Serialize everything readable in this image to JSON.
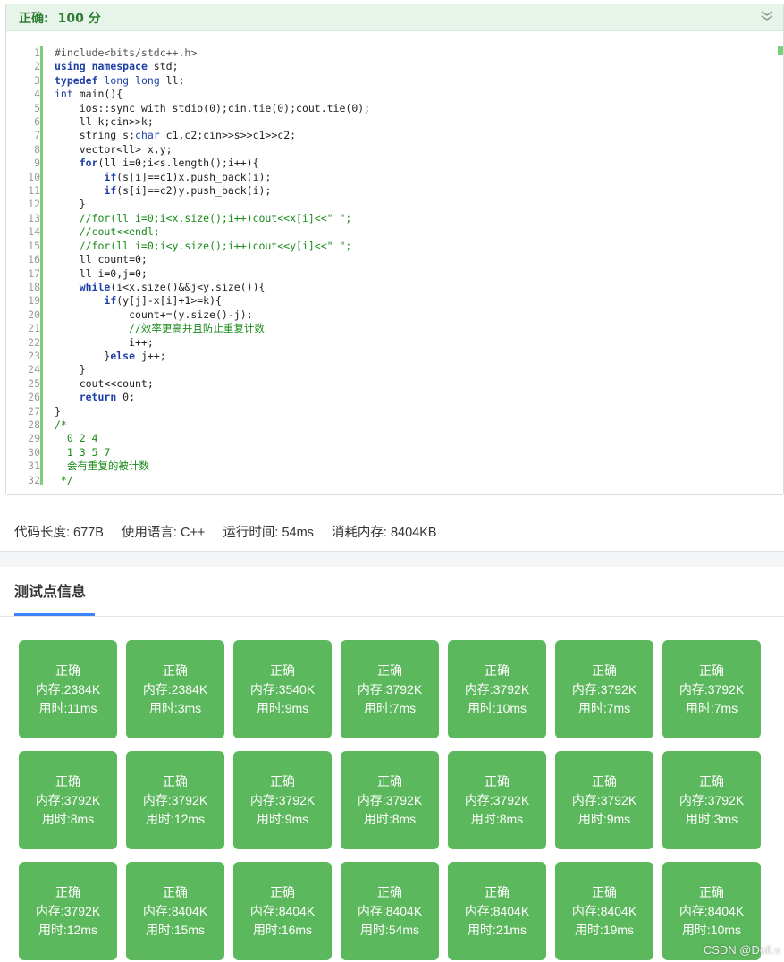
{
  "header": {
    "status": "正确:",
    "score": "100 分"
  },
  "code": {
    "line_numbers": [
      "1",
      "2",
      "3",
      "4",
      "5",
      "6",
      "7",
      "8",
      "9",
      "10",
      "11",
      "12",
      "13",
      "14",
      "15",
      "16",
      "17",
      "18",
      "19",
      "20",
      "21",
      "22",
      "23",
      "24",
      "25",
      "26",
      "27",
      "28",
      "29",
      "30",
      "31",
      "32"
    ],
    "lines": [
      "#include<bits/stdc++.h>",
      "using namespace std;",
      "typedef long long ll;",
      "int main(){",
      "    ios::sync_with_stdio(0);cin.tie(0);cout.tie(0);",
      "    ll k;cin>>k;",
      "    string s;char c1,c2;cin>>s>>c1>>c2;",
      "    vector<ll> x,y;",
      "    for(ll i=0;i<s.length();i++){",
      "        if(s[i]==c1)x.push_back(i);",
      "        if(s[i]==c2)y.push_back(i);",
      "    }",
      "    //for(ll i=0;i<x.size();i++)cout<<x[i]<<\" \";",
      "    //cout<<endl;",
      "    //for(ll i=0;i<y.size();i++)cout<<y[i]<<\" \";",
      "    ll count=0;",
      "    ll i=0,j=0;",
      "    while(i<x.size()&&j<y.size()){",
      "        if(y[j]-x[i]+1>=k){",
      "            count+=(y.size()-j);",
      "            //效率更高并且防止重复计数",
      "            i++;",
      "        }else j++;",
      "    }",
      "    cout<<count;",
      "    return 0;",
      "}",
      "/*",
      "  0 2 4",
      "  1 3 5 7",
      "  会有重复的被计数",
      " */"
    ]
  },
  "stats": {
    "code_length": "代码长度: 677B",
    "language": "使用语言: C++",
    "run_time": "运行时间: 54ms",
    "memory": "消耗内存: 8404KB"
  },
  "tab": {
    "title": "测试点信息"
  },
  "colors": {
    "accepted": "#5cb85c",
    "header_bg": "#e6f4ea",
    "tab_accent": "#3b82f6"
  },
  "testcases": [
    {
      "status": "正确",
      "memory": "内存:2384K",
      "time": "用时:11ms"
    },
    {
      "status": "正确",
      "memory": "内存:2384K",
      "time": "用时:3ms"
    },
    {
      "status": "正确",
      "memory": "内存:3540K",
      "time": "用时:9ms"
    },
    {
      "status": "正确",
      "memory": "内存:3792K",
      "time": "用时:7ms"
    },
    {
      "status": "正确",
      "memory": "内存:3792K",
      "time": "用时:10ms"
    },
    {
      "status": "正确",
      "memory": "内存:3792K",
      "time": "用时:7ms"
    },
    {
      "status": "正确",
      "memory": "内存:3792K",
      "time": "用时:7ms"
    },
    {
      "status": "正确",
      "memory": "内存:3792K",
      "time": "用时:8ms"
    },
    {
      "status": "正确",
      "memory": "内存:3792K",
      "time": "用时:12ms"
    },
    {
      "status": "正确",
      "memory": "内存:3792K",
      "time": "用时:9ms"
    },
    {
      "status": "正确",
      "memory": "内存:3792K",
      "time": "用时:8ms"
    },
    {
      "status": "正确",
      "memory": "内存:3792K",
      "time": "用时:8ms"
    },
    {
      "status": "正确",
      "memory": "内存:3792K",
      "time": "用时:9ms"
    },
    {
      "status": "正确",
      "memory": "内存:3792K",
      "time": "用时:3ms"
    },
    {
      "status": "正确",
      "memory": "内存:3792K",
      "time": "用时:12ms"
    },
    {
      "status": "正确",
      "memory": "内存:8404K",
      "time": "用时:15ms"
    },
    {
      "status": "正确",
      "memory": "内存:8404K",
      "time": "用时:16ms"
    },
    {
      "status": "正确",
      "memory": "内存:8404K",
      "time": "用时:54ms"
    },
    {
      "status": "正确",
      "memory": "内存:8404K",
      "time": "用时:21ms"
    },
    {
      "status": "正确",
      "memory": "内存:8404K",
      "time": "用时:19ms"
    },
    {
      "status": "正确",
      "memory": "内存:8404K",
      "time": "用时:10ms"
    }
  ],
  "watermark": "CSDN @Doll.v",
  "icons": {
    "collapse": "chevron-double-down-icon"
  }
}
